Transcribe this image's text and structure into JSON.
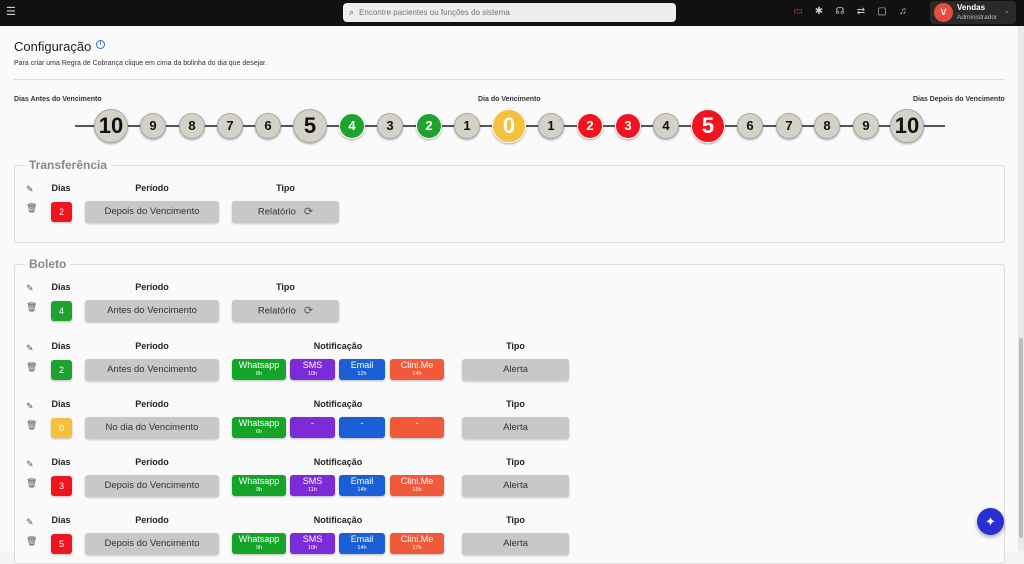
{
  "search": {
    "placeholder": "Encontre pacientes ou funções do sistema"
  },
  "user": {
    "initial": "V",
    "name": "Vendas",
    "role": "Administrador"
  },
  "colors": {
    "green": "#1fa22e",
    "red": "#f0141e",
    "yellow": "#f5c13b",
    "gray": "#d4d2c6",
    "whatsapp": "#14a428",
    "sms": "#7b2bd8",
    "email": "#1a5fd8",
    "clinime": "#f0593a"
  },
  "page": {
    "title": "Configuração",
    "subtitle": "Para criar uma Regra de Cobrança clique em cima da bolinha do dia que desejar."
  },
  "timeline": {
    "before_label": "Dias Antes do Vencimento",
    "due_label": "Dia do Vencimento",
    "after_label": "Dias Depois do Vencimento",
    "dots": [
      {
        "v": "10",
        "c": "gray",
        "big": true
      },
      {
        "v": "9",
        "c": "gray"
      },
      {
        "v": "8",
        "c": "gray"
      },
      {
        "v": "7",
        "c": "gray"
      },
      {
        "v": "6",
        "c": "gray"
      },
      {
        "v": "5",
        "c": "gray",
        "big": true
      },
      {
        "v": "4",
        "c": "green"
      },
      {
        "v": "3",
        "c": "gray"
      },
      {
        "v": "2",
        "c": "green"
      },
      {
        "v": "1",
        "c": "gray"
      },
      {
        "v": "0",
        "c": "yellow",
        "big": true
      },
      {
        "v": "1",
        "c": "gray"
      },
      {
        "v": "2",
        "c": "red"
      },
      {
        "v": "3",
        "c": "red"
      },
      {
        "v": "4",
        "c": "gray"
      },
      {
        "v": "5",
        "c": "red",
        "big": true
      },
      {
        "v": "6",
        "c": "gray"
      },
      {
        "v": "7",
        "c": "gray"
      },
      {
        "v": "8",
        "c": "gray"
      },
      {
        "v": "9",
        "c": "gray"
      },
      {
        "v": "10",
        "c": "gray",
        "big": true
      }
    ]
  },
  "headers": {
    "dias": "Dias",
    "periodo": "Período",
    "tipo": "Tipo",
    "notificacao": "Notificação"
  },
  "transferencia": {
    "title": "Transferência",
    "rules": [
      {
        "day": "2",
        "color": "red",
        "period": "Depois do Vencimento",
        "tipo": "Relatório"
      }
    ]
  },
  "boleto": {
    "title": "Boleto",
    "report_rule": {
      "day": "4",
      "color": "green",
      "period": "Antes do Vencimento",
      "tipo": "Relatório"
    },
    "alert_rules": [
      {
        "day": "2",
        "color": "green",
        "period": "Antes do Vencimento",
        "tipo": "Alerta",
        "notifs": [
          {
            "name": "Whatsapp",
            "time": "8h"
          },
          {
            "name": "SMS",
            "time": "10h"
          },
          {
            "name": "Email",
            "time": "12h"
          },
          {
            "name": "Clini.Me",
            "time": "14h"
          }
        ]
      },
      {
        "day": "0",
        "color": "yellow",
        "period": "No dia do Vencimento",
        "tipo": "Alerta",
        "notifs": [
          {
            "name": "Whatsapp",
            "time": "6h"
          },
          {
            "name": "-",
            "time": ""
          },
          {
            "name": "-",
            "time": ""
          },
          {
            "name": "-",
            "time": ""
          }
        ]
      },
      {
        "day": "3",
        "color": "red",
        "period": "Depois do Vencimento",
        "tipo": "Alerta",
        "notifs": [
          {
            "name": "Whatsapp",
            "time": "9h"
          },
          {
            "name": "SMS",
            "time": "11h"
          },
          {
            "name": "Email",
            "time": "14h"
          },
          {
            "name": "Clini.Me",
            "time": "15h"
          }
        ]
      },
      {
        "day": "5",
        "color": "red",
        "period": "Depois do Vencimento",
        "tipo": "Alerta",
        "notifs": [
          {
            "name": "Whatsapp",
            "time": "9h"
          },
          {
            "name": "SMS",
            "time": "10h"
          },
          {
            "name": "Email",
            "time": "14h"
          },
          {
            "name": "Clini.Me",
            "time": "17h"
          }
        ]
      }
    ]
  }
}
